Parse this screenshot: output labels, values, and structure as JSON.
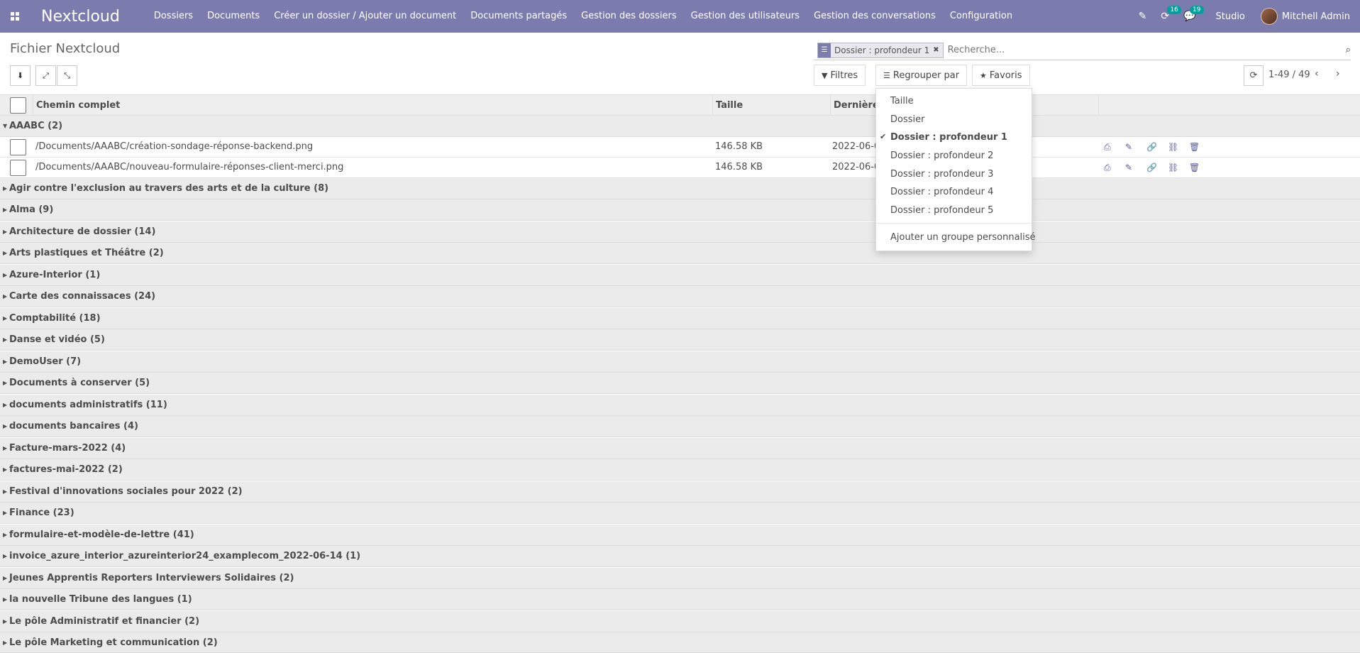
{
  "navbar": {
    "brand": "Nextcloud",
    "menu": [
      "Dossiers",
      "Documents",
      "Créer un dossier / Ajouter un document",
      "Documents partagés",
      "Gestion des dossiers",
      "Gestion des utilisateurs",
      "Gestion des conversations",
      "Configuration"
    ],
    "activity_badge": "16",
    "messages_badge": "19",
    "studio": "Studio",
    "user": "Mitchell Admin"
  },
  "control_panel": {
    "title": "Fichier Nextcloud",
    "search": {
      "facet_value": "Dossier : profondeur 1",
      "placeholder": "Recherche..."
    },
    "filters_label": "Filtres",
    "group_by_label": "Regrouper par",
    "favorites_label": "Favoris",
    "pager": "1-49 / 49"
  },
  "group_by_dropdown": {
    "options": [
      "Taille",
      "Dossier",
      "Dossier : profondeur 1",
      "Dossier : profondeur 2",
      "Dossier : profondeur 3",
      "Dossier : profondeur 4",
      "Dossier : profondeur 5"
    ],
    "selected": "Dossier : profondeur 1",
    "custom_group": "Ajouter un groupe personnalisé"
  },
  "table": {
    "columns": [
      "Chemin complet",
      "Taille",
      "Dernière m"
    ],
    "expanded_group": "AAABC (2)",
    "records": [
      {
        "path": "/Documents/AAABC/création-sondage-réponse-backend.png",
        "size": "146.58 KB",
        "date": "2022-06-08"
      },
      {
        "path": "/Documents/AAABC/nouveau-formulaire-réponses-client-merci.png",
        "size": "146.58 KB",
        "date": "2022-06-08"
      }
    ],
    "groups": [
      "Agir contre l'exclusion au travers des arts et de la culture (8)",
      "Alma (9)",
      "Architecture de dossier (14)",
      "Arts plastiques et Théâtre (2)",
      "Azure-Interior (1)",
      "Carte des connaissaces (24)",
      "Comptabilité (18)",
      "Danse et vidéo (5)",
      "DemoUser (7)",
      "Documents à conserver (5)",
      "documents administratifs (11)",
      "documents bancaires (4)",
      "Facture-mars-2022 (4)",
      "factures-mai-2022 (2)",
      "Festival d'innovations sociales pour 2022 (2)",
      "Finance (23)",
      "formulaire-et-modèle-de-lettre (41)",
      "invoice_azure_interior_azureinterior24_examplecom_2022-06-14 (1)",
      "Jeunes Apprentis Reporters Interviewers Solidaires (2)",
      "la nouvelle Tribune des langues (1)",
      "Le pôle Administratif et financier (2)",
      "Le pôle Marketing et communication (2)"
    ]
  }
}
